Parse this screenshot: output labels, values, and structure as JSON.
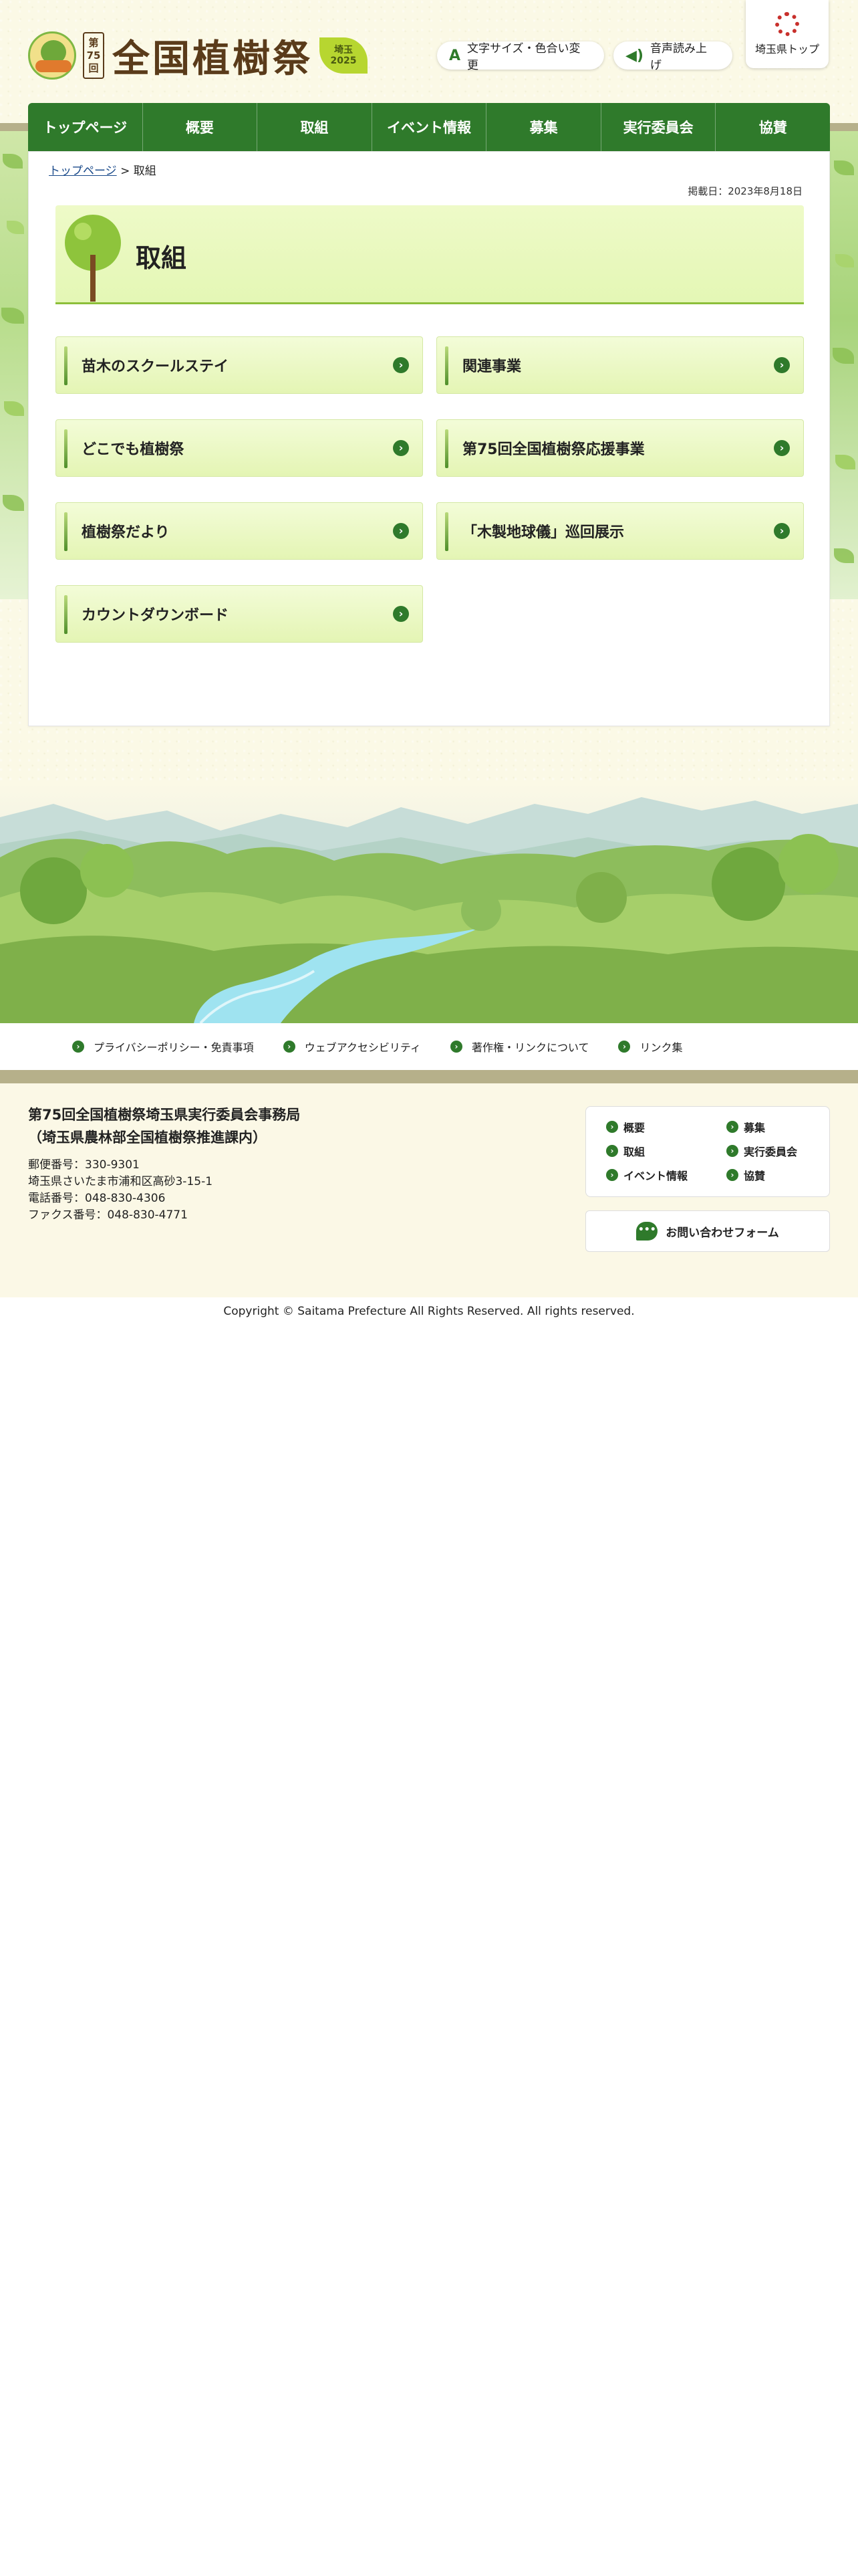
{
  "header": {
    "logo_number_top": "第",
    "logo_number_mid": "75",
    "logo_number_bottom": "回",
    "logo_title": "全国植樹祭",
    "logo_badge_top": "埼玉",
    "logo_badge_bottom": "2025",
    "font_size_button": "文字サイズ・色合い変更",
    "voice_button": "音声読み上げ",
    "pref_top": "埼玉県トップ"
  },
  "nav": [
    "トップページ",
    "概要",
    "取組",
    "イベント情報",
    "募集",
    "実行委員会",
    "協賛"
  ],
  "breadcrumb": {
    "home": "トップページ",
    "separator": ">",
    "current": "取組"
  },
  "published": "掲載日：2023年8月18日",
  "page_title": "取組",
  "cards": [
    "苗木のスクールステイ",
    "関連事業",
    "どこでも植樹祭",
    "第75回全国植樹祭応援事業",
    "植樹祭だより",
    "「木製地球儀」巡回展示",
    "カウントダウンボード"
  ],
  "footer_links": [
    "プライバシーポリシー・免責事項",
    "ウェブアクセシビリティ",
    "著作権・リンクについて",
    "リンク集"
  ],
  "footer": {
    "org_name_1": "第75回全国植樹祭埼玉県実行委員会事務局",
    "org_name_2": "（埼玉県農林部全国植樹祭推進課内）",
    "postal": "郵便番号：330-9301",
    "address": "埼玉県さいたま市浦和区高砂3-15-1",
    "tel": "電話番号：048-830-4306",
    "fax": "ファクス番号：048-830-4771",
    "nav": [
      "概要",
      "募集",
      "取組",
      "実行委員会",
      "イベント情報",
      "協賛"
    ],
    "contact": "お問い合わせフォーム"
  },
  "copyright": "Copyright © Saitama Prefecture All Rights Reserved. All rights reserved.",
  "colors": {
    "brand_green": "#2f7a2b",
    "band": "#b6b08a",
    "card_bg": "#e4f5b4",
    "page_bg": "#fbf9e6"
  },
  "icons": {
    "font_size": "font-size-icon",
    "voice": "speaker-icon",
    "pref_logo": "saitama-sun-icon",
    "card_arrow": "chevron-right-icon",
    "contact": "chat-bubble-icon"
  }
}
